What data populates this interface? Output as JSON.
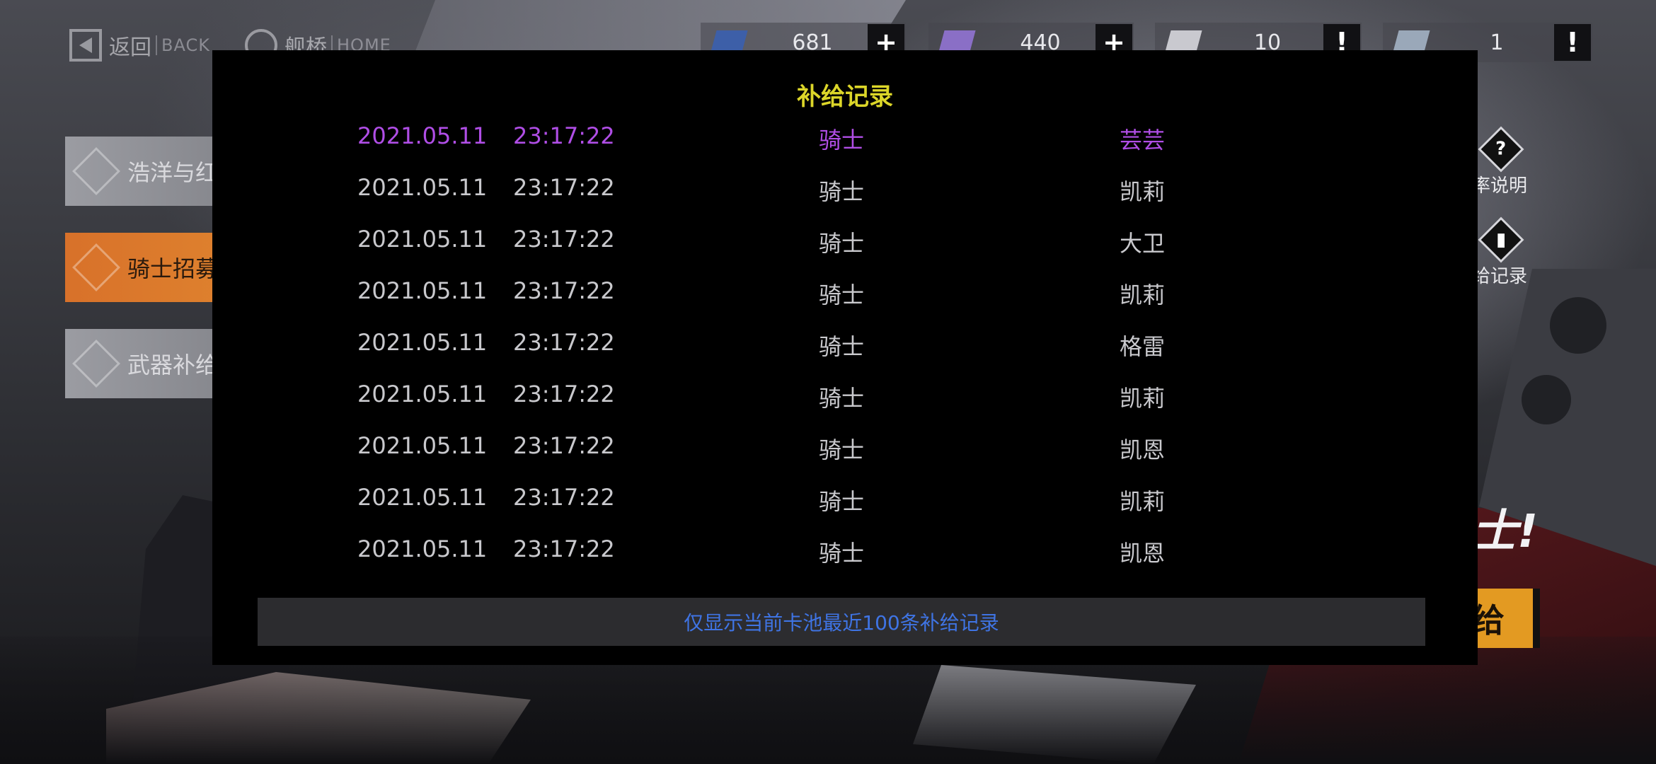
{
  "topbar": {
    "back": {
      "zh": "返回",
      "en": "BACK"
    },
    "home": {
      "zh": "舰桥",
      "en": "HOME"
    },
    "resources": [
      {
        "icon": "ticket-card-icon",
        "amount": "681",
        "action": "+",
        "color": "#3d5fa8"
      },
      {
        "icon": "crystal-cube-icon",
        "amount": "440",
        "action": "+",
        "color": "#8a6fc6"
      },
      {
        "icon": "recruit-permit-icon",
        "amount": "10",
        "action": "!",
        "color": "#c9c9cf"
      },
      {
        "icon": "supply-permit-icon",
        "amount": "1",
        "action": "!",
        "color": "#9aa8b9"
      }
    ]
  },
  "left_tabs": [
    {
      "label": "浩洋与红月",
      "active": false
    },
    {
      "label": "骑士招募",
      "active": true
    },
    {
      "label": "武器补给",
      "active": false
    }
  ],
  "right_side": {
    "rate_info": {
      "icon": "?",
      "label": "率说明"
    },
    "supply_log": {
      "label": "给记录"
    },
    "banner_text": "士!",
    "supply_button": "给"
  },
  "modal": {
    "title": "补给记录",
    "records": [
      {
        "date": "2021.05.11",
        "time": "23:17:22",
        "type": "骑士",
        "name": "芸芸",
        "highlight": true
      },
      {
        "date": "2021.05.11",
        "time": "23:17:22",
        "type": "骑士",
        "name": "凯莉",
        "highlight": false
      },
      {
        "date": "2021.05.11",
        "time": "23:17:22",
        "type": "骑士",
        "name": "大卫",
        "highlight": false
      },
      {
        "date": "2021.05.11",
        "time": "23:17:22",
        "type": "骑士",
        "name": "凯莉",
        "highlight": false
      },
      {
        "date": "2021.05.11",
        "time": "23:17:22",
        "type": "骑士",
        "name": "格雷",
        "highlight": false
      },
      {
        "date": "2021.05.11",
        "time": "23:17:22",
        "type": "骑士",
        "name": "凯莉",
        "highlight": false
      },
      {
        "date": "2021.05.11",
        "time": "23:17:22",
        "type": "骑士",
        "name": "凯恩",
        "highlight": false
      },
      {
        "date": "2021.05.11",
        "time": "23:17:22",
        "type": "骑士",
        "name": "凯莉",
        "highlight": false
      },
      {
        "date": "2021.05.11",
        "time": "23:17:22",
        "type": "骑士",
        "name": "凯恩",
        "highlight": false
      }
    ],
    "footer_note": "仅显示当前卡池最近100条补给记录"
  },
  "colors": {
    "title": "#dcd629",
    "highlight_row": "#b04ee6",
    "note": "#3f74e4",
    "active_tab": "#e0862f"
  }
}
